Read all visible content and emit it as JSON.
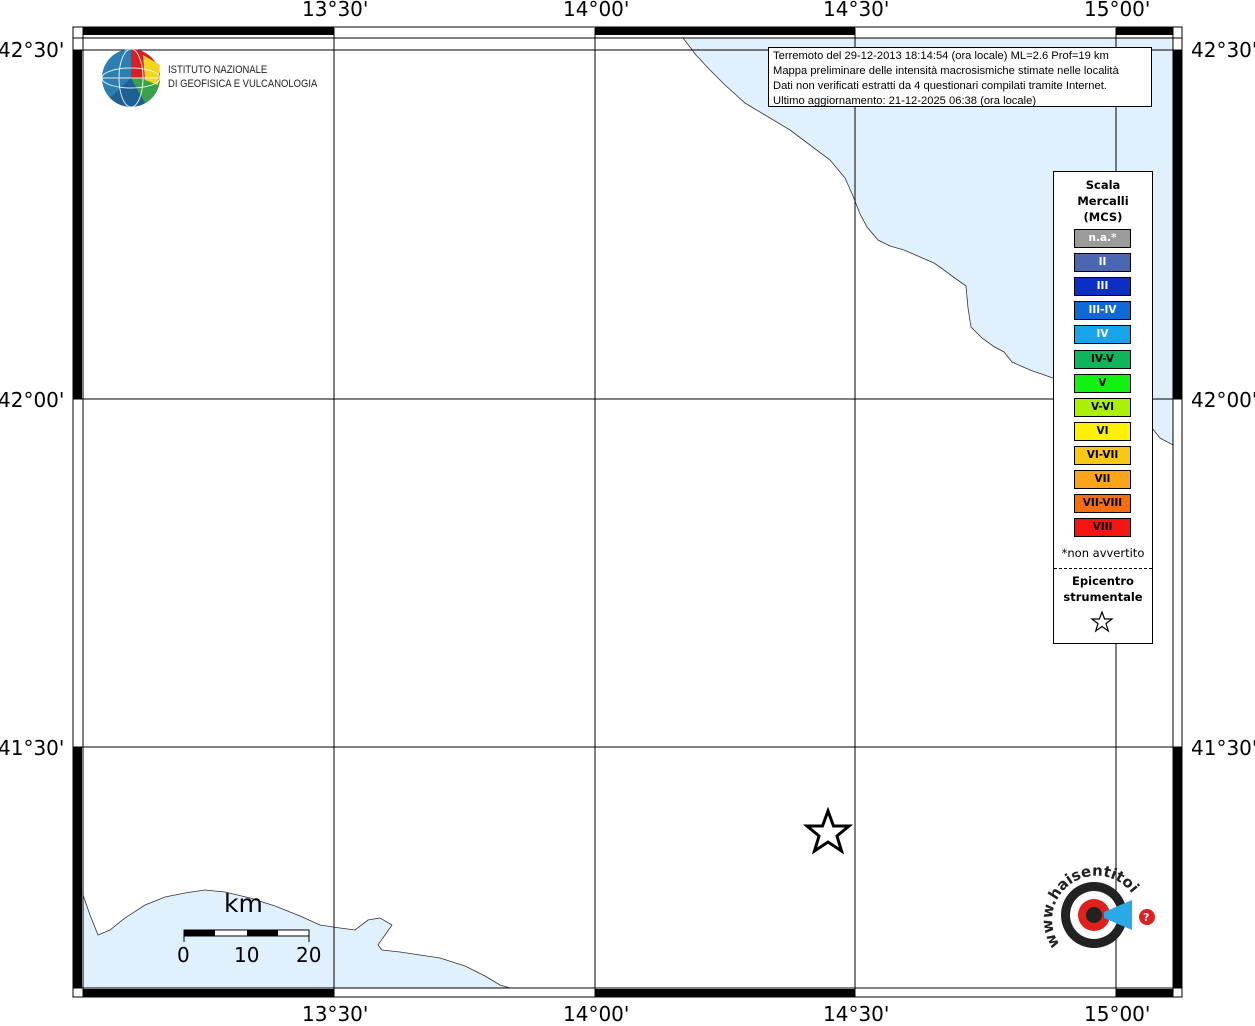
{
  "map": {
    "land_color": "#ffffff",
    "sea_color": "#e0f0fd",
    "grid_color": "#000000",
    "epicenter_marker": "star-icon"
  },
  "axes": {
    "longitude_labels": [
      "13°30'",
      "14°00'",
      "14°30'",
      "15°00'"
    ],
    "latitude_labels": [
      "42°30'",
      "42°00'",
      "41°30'"
    ]
  },
  "info_box": {
    "lines": [
      "Terremoto del 29-12-2013 18:14:54 (ora locale) ML=2.6 Prof=19 km",
      "Mappa preliminare delle intensità macrosismiche stimate nelle località",
      "Dati non verificati estratti da 4 questionari compilati tramite Internet.",
      "Ultimo aggiornamento: 21-12-2025 06:38 (ora locale)"
    ]
  },
  "legend": {
    "title": "Scala\nMercalli\n(MCS)",
    "items": [
      {
        "label": "n.a.*",
        "color": "#9b9b9b",
        "text_color": "#ffffff"
      },
      {
        "label": "II",
        "color": "#4a67b2",
        "text_color": "#ffffff"
      },
      {
        "label": "III",
        "color": "#0a2ec6",
        "text_color": "#ffffff"
      },
      {
        "label": "III-IV",
        "color": "#0f68d8",
        "text_color": "#ffffff"
      },
      {
        "label": "IV",
        "color": "#16a4ea",
        "text_color": "#ffffff"
      },
      {
        "label": "IV-V",
        "color": "#10b45a",
        "text_color": "#000000"
      },
      {
        "label": "V",
        "color": "#12f112",
        "text_color": "#000000"
      },
      {
        "label": "V-VI",
        "color": "#aaf000",
        "text_color": "#000000"
      },
      {
        "label": "VI",
        "color": "#fdf000",
        "text_color": "#000000"
      },
      {
        "label": "VI-VII",
        "color": "#f9c814",
        "text_color": "#000000"
      },
      {
        "label": "VII",
        "color": "#fba41a",
        "text_color": "#000000"
      },
      {
        "label": "VII-VIII",
        "color": "#f96e0c",
        "text_color": "#000000"
      },
      {
        "label": "VIII",
        "color": "#f41414",
        "text_color": "#000000"
      }
    ],
    "note": "*non avvertito",
    "epicenter_label": "Epicentro\nstrumentale"
  },
  "logo_ingv": {
    "line1": "ISTITUTO NAZIONALE",
    "line2": "DI GEOFISICA E VULCANOLOGIA"
  },
  "logo_hsit": {
    "text": "www.haisentitoilterremoto.it",
    "accent": "#e0201c"
  },
  "scale_bar": {
    "unit": "km",
    "ticks": [
      "0",
      "10",
      "20"
    ]
  }
}
